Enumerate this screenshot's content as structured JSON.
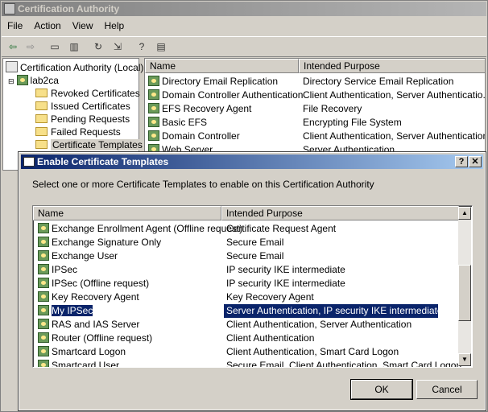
{
  "main_window": {
    "title": "Certification Authority",
    "menu": [
      "File",
      "Action",
      "View",
      "Help"
    ],
    "tree": {
      "root": "Certification Authority (Local)",
      "ca": "lab2ca",
      "folders": [
        "Revoked Certificates",
        "Issued Certificates",
        "Pending Requests",
        "Failed Requests",
        "Certificate Templates"
      ]
    },
    "list": {
      "col_name": "Name",
      "col_purpose": "Intended Purpose",
      "rows": [
        {
          "name": "Directory Email Replication",
          "purpose": "Directory Service Email Replication"
        },
        {
          "name": "Domain Controller Authentication",
          "purpose": "Client Authentication, Server Authenticatio..."
        },
        {
          "name": "EFS Recovery Agent",
          "purpose": "File Recovery"
        },
        {
          "name": "Basic EFS",
          "purpose": "Encrypting File System"
        },
        {
          "name": "Domain Controller",
          "purpose": "Client Authentication, Server Authentication"
        },
        {
          "name": "Web Server",
          "purpose": "Server Authentication"
        }
      ]
    }
  },
  "dialog": {
    "title": "Enable Certificate Templates",
    "help_btn": "?",
    "close_btn": "✕",
    "instruction": "Select one or more Certificate Templates to enable on this Certification Authority",
    "col_name": "Name",
    "col_purpose": "Intended Purpose",
    "rows": [
      {
        "name": "Exchange Enrollment Agent (Offline request)",
        "purpose": "Certificate Request Agent"
      },
      {
        "name": "Exchange Signature Only",
        "purpose": "Secure Email"
      },
      {
        "name": "Exchange User",
        "purpose": "Secure Email"
      },
      {
        "name": "IPSec",
        "purpose": "IP security IKE intermediate"
      },
      {
        "name": "IPSec (Offline request)",
        "purpose": "IP security IKE intermediate"
      },
      {
        "name": "Key Recovery Agent",
        "purpose": "Key Recovery Agent"
      },
      {
        "name": "My IPSec",
        "purpose": "Server Authentication, IP security IKE intermediate"
      },
      {
        "name": "RAS and IAS Server",
        "purpose": "Client Authentication, Server Authentication"
      },
      {
        "name": "Router (Offline request)",
        "purpose": "Client Authentication"
      },
      {
        "name": "Smartcard Logon",
        "purpose": "Client Authentication, Smart Card Logon"
      },
      {
        "name": "Smartcard User",
        "purpose": "Secure Email, Client Authentication, Smart Card Logon"
      }
    ],
    "ok": "OK",
    "cancel": "Cancel"
  }
}
